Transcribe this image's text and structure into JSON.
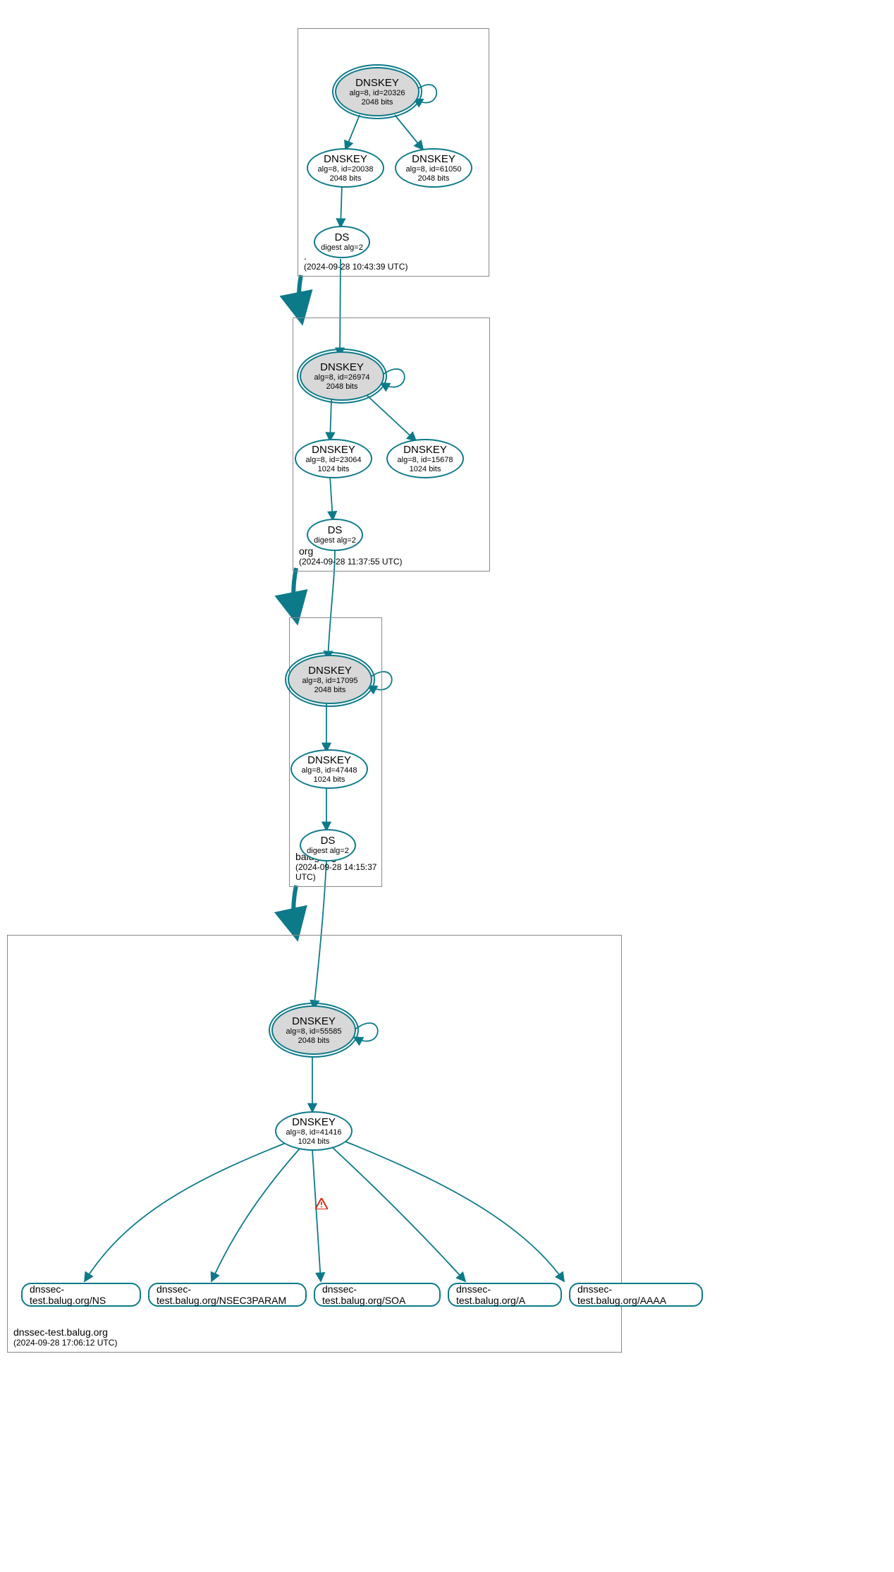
{
  "chart_data": {
    "type": "graph",
    "description": "DNSSEC authentication chain (DNSViz-style)",
    "zones": [
      {
        "name": ".",
        "timestamp": "2024-09-28 10:43:39 UTC"
      },
      {
        "name": "org",
        "timestamp": "2024-09-28 11:37:55 UTC"
      },
      {
        "name": "balug.org",
        "timestamp": "2024-09-28 14:15:37 UTC"
      },
      {
        "name": "dnssec-test.balug.org",
        "timestamp": "2024-09-28 17:06:12 UTC"
      }
    ],
    "nodes": [
      {
        "id": "root-ksk",
        "zone": ".",
        "type": "DNSKEY",
        "alg": 8,
        "keyid": 20326,
        "bits": 2048,
        "ksk": true
      },
      {
        "id": "root-zsk1",
        "zone": ".",
        "type": "DNSKEY",
        "alg": 8,
        "keyid": 20038,
        "bits": 2048
      },
      {
        "id": "root-zsk2",
        "zone": ".",
        "type": "DNSKEY",
        "alg": 8,
        "keyid": 61050,
        "bits": 2048
      },
      {
        "id": "root-ds",
        "zone": ".",
        "type": "DS",
        "digest_alg": 2
      },
      {
        "id": "org-ksk",
        "zone": "org",
        "type": "DNSKEY",
        "alg": 8,
        "keyid": 26974,
        "bits": 2048,
        "ksk": true
      },
      {
        "id": "org-zsk1",
        "zone": "org",
        "type": "DNSKEY",
        "alg": 8,
        "keyid": 23064,
        "bits": 1024
      },
      {
        "id": "org-zsk2",
        "zone": "org",
        "type": "DNSKEY",
        "alg": 8,
        "keyid": 15678,
        "bits": 1024
      },
      {
        "id": "org-ds",
        "zone": "org",
        "type": "DS",
        "digest_alg": 2
      },
      {
        "id": "balug-ksk",
        "zone": "balug.org",
        "type": "DNSKEY",
        "alg": 8,
        "keyid": 17095,
        "bits": 2048,
        "ksk": true
      },
      {
        "id": "balug-zsk",
        "zone": "balug.org",
        "type": "DNSKEY",
        "alg": 8,
        "keyid": 47448,
        "bits": 1024
      },
      {
        "id": "balug-ds",
        "zone": "balug.org",
        "type": "DS",
        "digest_alg": 2
      },
      {
        "id": "dt-ksk",
        "zone": "dnssec-test.balug.org",
        "type": "DNSKEY",
        "alg": 8,
        "keyid": 55585,
        "bits": 2048,
        "ksk": true
      },
      {
        "id": "dt-zsk",
        "zone": "dnssec-test.balug.org",
        "type": "DNSKEY",
        "alg": 8,
        "keyid": 41416,
        "bits": 1024
      }
    ],
    "rrsets": [
      {
        "id": "rr-ns",
        "label": "dnssec-test.balug.org/NS"
      },
      {
        "id": "rr-n3p",
        "label": "dnssec-test.balug.org/NSEC3PARAM"
      },
      {
        "id": "rr-soa",
        "label": "dnssec-test.balug.org/SOA",
        "warning": true
      },
      {
        "id": "rr-a",
        "label": "dnssec-test.balug.org/A"
      },
      {
        "id": "rr-aaaa",
        "label": "dnssec-test.balug.org/AAAA"
      }
    ],
    "edges": [
      [
        "root-ksk",
        "root-ksk",
        "self"
      ],
      [
        "root-ksk",
        "root-zsk1"
      ],
      [
        "root-ksk",
        "root-zsk2"
      ],
      [
        "root-zsk1",
        "root-ds"
      ],
      [
        "root-ds",
        "org-ksk"
      ],
      [
        "org-ksk",
        "org-ksk",
        "self"
      ],
      [
        "org-ksk",
        "org-zsk1"
      ],
      [
        "org-ksk",
        "org-zsk2"
      ],
      [
        "org-zsk1",
        "org-ds"
      ],
      [
        "org-ds",
        "balug-ksk"
      ],
      [
        "balug-ksk",
        "balug-ksk",
        "self"
      ],
      [
        "balug-ksk",
        "balug-zsk"
      ],
      [
        "balug-zsk",
        "balug-ds"
      ],
      [
        "balug-ds",
        "dt-ksk"
      ],
      [
        "dt-ksk",
        "dt-ksk",
        "self"
      ],
      [
        "dt-ksk",
        "dt-zsk"
      ],
      [
        "dt-zsk",
        "rr-ns"
      ],
      [
        "dt-zsk",
        "rr-n3p"
      ],
      [
        "dt-zsk",
        "rr-soa"
      ],
      [
        "dt-zsk",
        "rr-a"
      ],
      [
        "dt-zsk",
        "rr-aaaa"
      ]
    ]
  },
  "labels": {
    "dnskey": "DNSKEY",
    "ds": "DS",
    "alg_prefix": "alg=",
    "id_prefix": "id=",
    "bits_suffix": " bits",
    "digest_prefix": "digest alg="
  }
}
